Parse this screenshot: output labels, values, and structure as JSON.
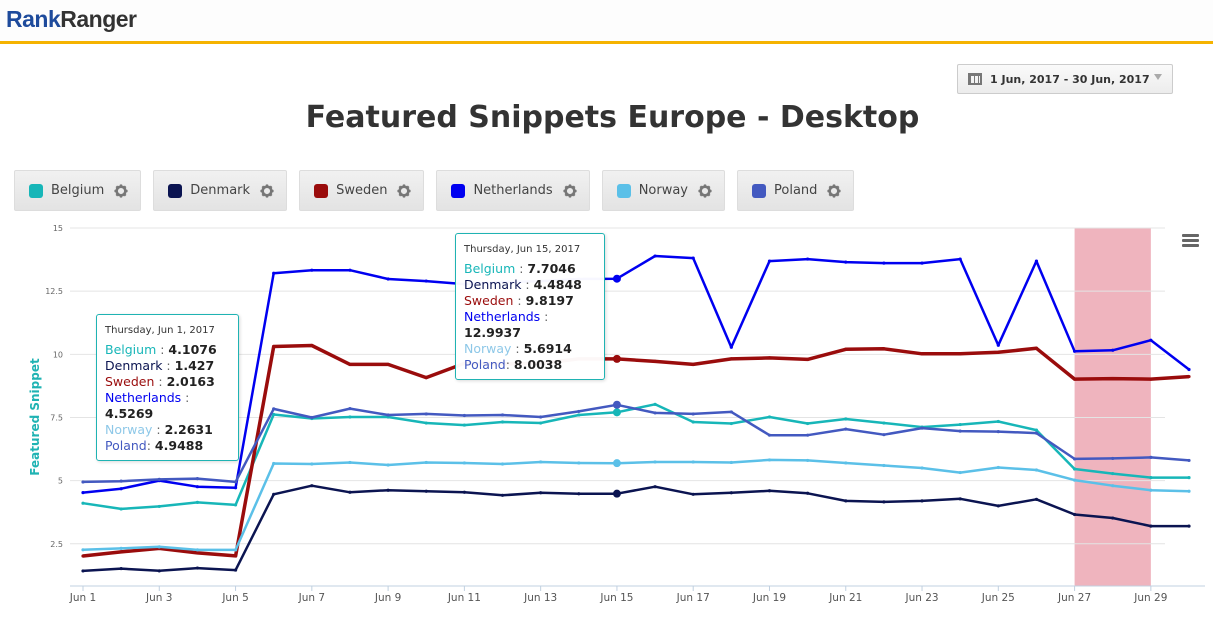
{
  "header": {
    "logo_part1": "Rank",
    "logo_part2": "Ranger"
  },
  "date_range": {
    "label": "1 Jun, 2017 - 30 Jun, 2017",
    "icon": "calendar-icon"
  },
  "legend": [
    {
      "name": "Belgium",
      "color": "#17b6b8"
    },
    {
      "name": "Denmark",
      "color": "#0b1451"
    },
    {
      "name": "Sweden",
      "color": "#9a0c0c"
    },
    {
      "name": "Netherlands",
      "color": "#0000f0"
    },
    {
      "name": "Norway",
      "color": "#5bc0e8"
    },
    {
      "name": "Poland",
      "color": "#4359c0"
    }
  ],
  "tooltips": [
    {
      "date": "Thursday, Jun 1, 2017",
      "rows": [
        {
          "label": "Belgium",
          "sep": " : ",
          "value": "4.1076"
        },
        {
          "label": "Denmark",
          "sep": " : ",
          "value": "1.427"
        },
        {
          "label": "Sweden",
          "sep": " : ",
          "value": "2.0163"
        },
        {
          "label": "Netherlands",
          "sep": " : ",
          "value": "4.5269"
        },
        {
          "label": "Norway",
          "sep": " : ",
          "value": "2.2631"
        },
        {
          "label": "Poland",
          "sep": ": ",
          "value": "4.9488"
        }
      ]
    },
    {
      "date": "Thursday, Jun 15, 2017",
      "rows": [
        {
          "label": "Belgium",
          "sep": " : ",
          "value": "7.7046"
        },
        {
          "label": "Denmark",
          "sep": " : ",
          "value": "4.4848"
        },
        {
          "label": "Sweden",
          "sep": " : ",
          "value": "9.8197"
        },
        {
          "label": "Netherlands",
          "sep": " : ",
          "value": "12.9937"
        },
        {
          "label": "Norway",
          "sep": " : ",
          "value": "5.6914"
        },
        {
          "label": "Poland",
          "sep": ": ",
          "value": "8.0038"
        }
      ]
    }
  ],
  "chart_data": {
    "type": "line",
    "title": "Featured Snippets Europe - Desktop",
    "xlabel": "",
    "ylabel": "Featured Snippet",
    "ylim": [
      0.83,
      15
    ],
    "yticks": [
      2.5,
      5,
      7.5,
      10,
      12.5,
      15
    ],
    "ytick_labels": [
      "2.5",
      "5",
      "7.5",
      "10",
      "12.5",
      "15"
    ],
    "x": [
      "Jun 1",
      "Jun 2",
      "Jun 3",
      "Jun 4",
      "Jun 5",
      "Jun 6",
      "Jun 7",
      "Jun 8",
      "Jun 9",
      "Jun 10",
      "Jun 11",
      "Jun 12",
      "Jun 13",
      "Jun 14",
      "Jun 15",
      "Jun 16",
      "Jun 17",
      "Jun 18",
      "Jun 19",
      "Jun 20",
      "Jun 21",
      "Jun 22",
      "Jun 23",
      "Jun 24",
      "Jun 25",
      "Jun 26",
      "Jun 27",
      "Jun 28",
      "Jun 29",
      "Jun 30"
    ],
    "xtick_labels": [
      "Jun 1",
      "Jun 3",
      "Jun 5",
      "Jun 7",
      "Jun 9",
      "Jun 11",
      "Jun 13",
      "Jun 15",
      "Jun 17",
      "Jun 19",
      "Jun 21",
      "Jun 23",
      "Jun 25",
      "Jun 27",
      "Jun 29"
    ],
    "grid": true,
    "legend_position": "top-left",
    "highlight_band": {
      "from": "Jun 27",
      "to": "Jun 29",
      "color": "#efb4be"
    },
    "markers_at": "Jun 15",
    "series": [
      {
        "name": "Belgium",
        "color": "#17b6b8",
        "width": 2.5,
        "values": [
          4.1076,
          3.88,
          3.98,
          4.14,
          4.04,
          7.62,
          7.46,
          7.52,
          7.52,
          7.28,
          7.2,
          7.32,
          7.28,
          7.6,
          7.7046,
          8.02,
          7.32,
          7.26,
          7.52,
          7.26,
          7.44,
          7.28,
          7.12,
          7.22,
          7.34,
          7.0,
          5.46,
          5.28,
          5.12,
          5.12
        ]
      },
      {
        "name": "Denmark",
        "color": "#0b1451",
        "width": 2.5,
        "values": [
          1.427,
          1.52,
          1.43,
          1.54,
          1.46,
          4.46,
          4.8,
          4.54,
          4.62,
          4.58,
          4.54,
          4.42,
          4.52,
          4.48,
          4.4848,
          4.76,
          4.46,
          4.52,
          4.6,
          4.5,
          4.2,
          4.16,
          4.2,
          4.28,
          4.0,
          4.26,
          3.66,
          3.52,
          3.2,
          3.2
        ]
      },
      {
        "name": "Sweden",
        "color": "#9a0c0c",
        "width": 3.5,
        "values": [
          2.0163,
          2.18,
          2.32,
          2.14,
          2.02,
          10.31,
          10.35,
          9.6,
          9.6,
          9.08,
          9.64,
          9.62,
          9.64,
          9.82,
          9.8197,
          9.72,
          9.6,
          9.82,
          9.86,
          9.8,
          10.2,
          10.22,
          10.02,
          10.02,
          10.08,
          10.24,
          9.02,
          9.04,
          9.02,
          9.12
        ]
      },
      {
        "name": "Netherlands",
        "color": "#0000f0",
        "width": 2.5,
        "values": [
          4.5269,
          4.68,
          5.0,
          4.76,
          4.72,
          13.21,
          13.33,
          13.33,
          12.98,
          12.9,
          12.78,
          12.86,
          12.9,
          12.98,
          12.9937,
          13.89,
          13.81,
          10.28,
          13.69,
          13.77,
          13.65,
          13.61,
          13.61,
          13.77,
          10.36,
          13.69,
          10.12,
          10.16,
          10.56,
          9.4
        ]
      },
      {
        "name": "Norway",
        "color": "#5bc0e8",
        "width": 2.5,
        "values": [
          2.2631,
          2.32,
          2.38,
          2.26,
          2.26,
          5.68,
          5.66,
          5.72,
          5.62,
          5.72,
          5.7,
          5.66,
          5.74,
          5.7,
          5.6914,
          5.74,
          5.74,
          5.72,
          5.82,
          5.8,
          5.7,
          5.6,
          5.5,
          5.32,
          5.52,
          5.42,
          5.02,
          4.8,
          4.62,
          4.58
        ]
      },
      {
        "name": "Poland",
        "color": "#4359c0",
        "width": 2.5,
        "values": [
          4.9488,
          4.98,
          5.05,
          5.08,
          4.95,
          7.84,
          7.5,
          7.85,
          7.6,
          7.64,
          7.58,
          7.6,
          7.52,
          7.74,
          8.0038,
          7.68,
          7.64,
          7.72,
          6.8,
          6.8,
          7.04,
          6.82,
          7.08,
          6.96,
          6.94,
          6.88,
          5.86,
          5.88,
          5.92,
          5.8
        ]
      }
    ]
  }
}
